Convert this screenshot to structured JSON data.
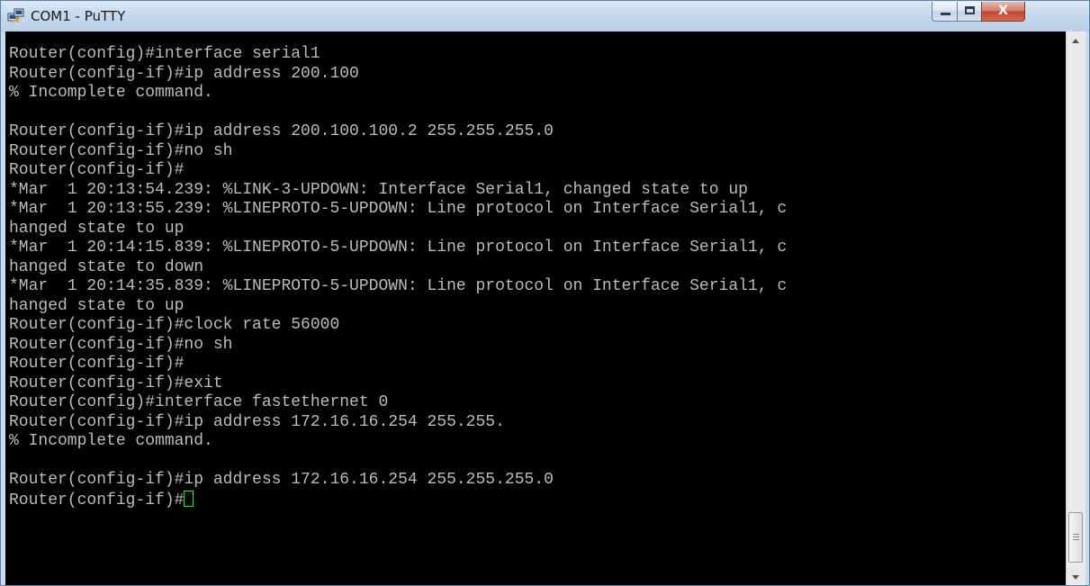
{
  "window": {
    "title": "COM1 - PuTTY",
    "app_icon": "putty-icon",
    "controls": {
      "minimize_icon": "minimize-icon",
      "maximize_icon": "maximize-icon",
      "close_icon": "close-icon",
      "close_glyph": "X"
    }
  },
  "terminal": {
    "lines": [
      "Router(config)#interface serial1",
      "Router(config-if)#ip address 200.100",
      "% Incomplete command.",
      "",
      "Router(config-if)#ip address 200.100.100.2 255.255.255.0",
      "Router(config-if)#no sh",
      "Router(config-if)#",
      "*Mar  1 20:13:54.239: %LINK-3-UPDOWN: Interface Serial1, changed state to up",
      "*Mar  1 20:13:55.239: %LINEPROTO-5-UPDOWN: Line protocol on Interface Serial1, c",
      "hanged state to up",
      "*Mar  1 20:14:15.839: %LINEPROTO-5-UPDOWN: Line protocol on Interface Serial1, c",
      "hanged state to down",
      "*Mar  1 20:14:35.839: %LINEPROTO-5-UPDOWN: Line protocol on Interface Serial1, c",
      "hanged state to up",
      "Router(config-if)#clock rate 56000",
      "Router(config-if)#no sh",
      "Router(config-if)#",
      "Router(config-if)#exit",
      "Router(config)#interface fastethernet 0",
      "Router(config-if)#ip address 172.16.16.254 255.255.",
      "% Incomplete command.",
      "",
      "Router(config-if)#ip address 172.16.16.254 255.255.255.0"
    ],
    "prompt": "Router(config-if)#",
    "text_color": "#bbbbbb",
    "background_color": "#000000",
    "cursor_color": "#00ff00"
  },
  "scrollbar": {
    "up_icon": "scroll-up-arrow-icon",
    "down_icon": "scroll-down-arrow-icon",
    "position": 1.0
  }
}
